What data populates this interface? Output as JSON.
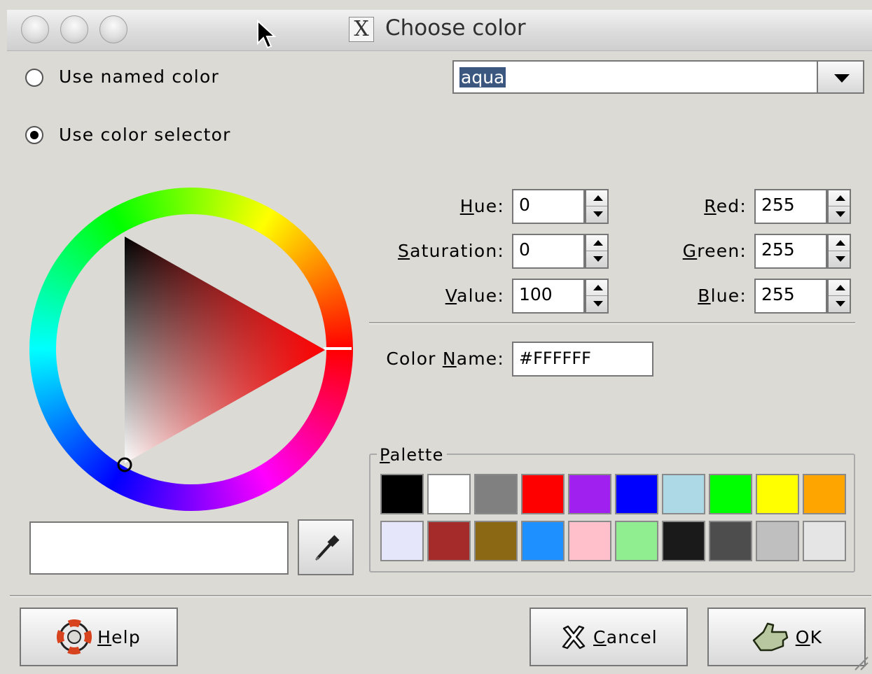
{
  "window": {
    "title": "Choose color",
    "title_icon": "X",
    "buttons": [
      "close",
      "minimize",
      "zoom"
    ]
  },
  "mode": {
    "named_label": "Use named color",
    "selector_label": "Use color selector",
    "selected": "selector"
  },
  "named_color": {
    "value": "aqua"
  },
  "hsv": {
    "hue_label": "Hue:",
    "hue_value": "0",
    "saturation_label": "Saturation:",
    "saturation_value": "0",
    "value_label": "Value:",
    "value_value": "100"
  },
  "rgb": {
    "red_label": "Red:",
    "red_value": "255",
    "green_label": "Green:",
    "green_value": "255",
    "blue_label": "Blue:",
    "blue_value": "255"
  },
  "color_name": {
    "label": "Color Name:",
    "value": "#FFFFFF"
  },
  "current_color": "#ffffff",
  "palette": {
    "label": "Palette",
    "colors": [
      "#000000",
      "#ffffff",
      "#808080",
      "#ff0000",
      "#a020f0",
      "#0000ff",
      "#add8e6",
      "#00ff00",
      "#ffff00",
      "#ffa500",
      "#e6e6fa",
      "#a52a2a",
      "#8b6914",
      "#1e90ff",
      "#ffc0cb",
      "#90ee90",
      "#1a1a1a",
      "#4d4d4d",
      "#bfbfbf",
      "#e5e5e5"
    ]
  },
  "buttons": {
    "help": "Help",
    "cancel": "Cancel",
    "ok": "OK"
  }
}
